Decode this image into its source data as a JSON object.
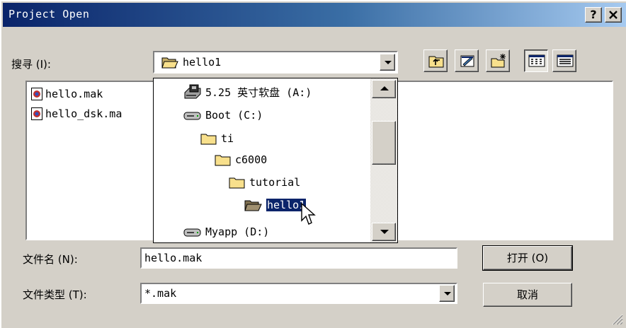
{
  "window": {
    "title": "Project Open",
    "help_label": "?",
    "close_label": "✕"
  },
  "look_in": {
    "label": "搜寻 (I):",
    "value": "hello1"
  },
  "files": [
    {
      "name": "hello.mak",
      "icon": "project-file-icon"
    },
    {
      "name": "hello_dsk.ma",
      "icon": "project-file-icon"
    }
  ],
  "dropdown_items": [
    {
      "label": "5.25 英寸软盘 (A:)",
      "icon": "floppy-drive-icon",
      "indent": 0
    },
    {
      "label": "Boot (C:)",
      "icon": "hard-drive-icon",
      "indent": 0
    },
    {
      "label": "ti",
      "icon": "folder-icon",
      "indent": 1
    },
    {
      "label": "c6000",
      "icon": "folder-icon",
      "indent": 2
    },
    {
      "label": "tutorial",
      "icon": "folder-icon",
      "indent": 3
    },
    {
      "label": "hello1",
      "icon": "open-folder-icon",
      "indent": 4,
      "selected": true
    },
    {
      "label": "Myapp (D:)",
      "icon": "hard-drive-icon",
      "indent": 0
    }
  ],
  "file_name": {
    "label": "文件名 (N):",
    "value": "hello.mak"
  },
  "file_type": {
    "label": "文件类型 (T):",
    "value": "*.mak"
  },
  "buttons": {
    "open": "打开 (O)",
    "cancel": "取消"
  },
  "colors": {
    "title_start": "#0a246a",
    "title_end": "#a6caf0",
    "face": "#d4d0c8",
    "selection": "#0a246a"
  }
}
